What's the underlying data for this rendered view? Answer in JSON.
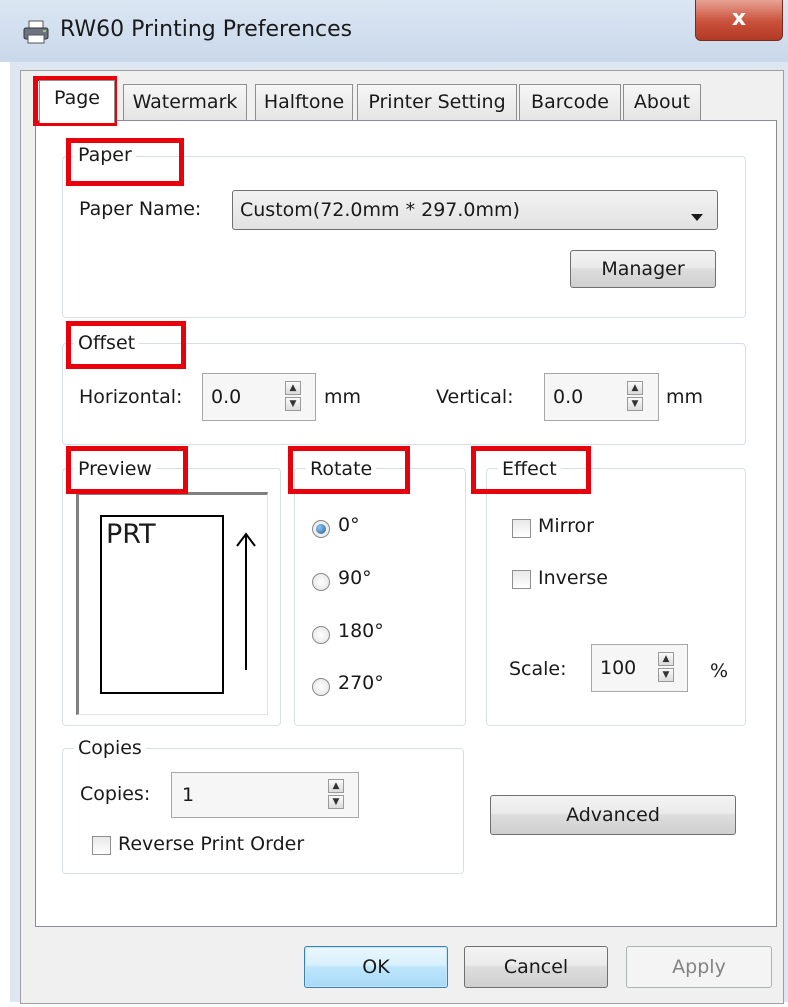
{
  "window": {
    "title": "RW60 Printing Preferences",
    "close_glyph": "x",
    "app_icon": "printer-icon"
  },
  "tabs": [
    {
      "label": "Page",
      "active": true
    },
    {
      "label": "Watermark"
    },
    {
      "label": "Halftone"
    },
    {
      "label": "Printer Setting"
    },
    {
      "label": "Barcode"
    },
    {
      "label": "About"
    }
  ],
  "paper": {
    "legend": "Paper",
    "name_label": "Paper Name:",
    "name_value": "Custom(72.0mm * 297.0mm)",
    "manager_button": "Manager"
  },
  "offset": {
    "legend": "Offset",
    "horizontal_label": "Horizontal:",
    "horizontal_value": "0.0",
    "horizontal_unit": "mm",
    "vertical_label": "Vertical:",
    "vertical_value": "0.0",
    "vertical_unit": "mm"
  },
  "preview": {
    "legend": "Preview",
    "sample_text": "PRT"
  },
  "rotate": {
    "legend": "Rotate",
    "options": [
      "0°",
      "90°",
      "180°",
      "270°"
    ],
    "selected": "0°"
  },
  "effect": {
    "legend": "Effect",
    "mirror_label": "Mirror",
    "mirror_checked": false,
    "inverse_label": "Inverse",
    "inverse_checked": false,
    "scale_label": "Scale:",
    "scale_value": "100",
    "scale_unit": "%"
  },
  "copies": {
    "legend": "Copies",
    "label": "Copies:",
    "value": "1",
    "reverse_label": "Reverse Print Order",
    "reverse_checked": false
  },
  "advanced_button": "Advanced",
  "footer": {
    "ok": "OK",
    "cancel": "Cancel",
    "apply": "Apply"
  },
  "colors": {
    "highlight_box": "#e8000b",
    "ok_border": "#3c7fb1",
    "close_button": "#c9503a"
  }
}
